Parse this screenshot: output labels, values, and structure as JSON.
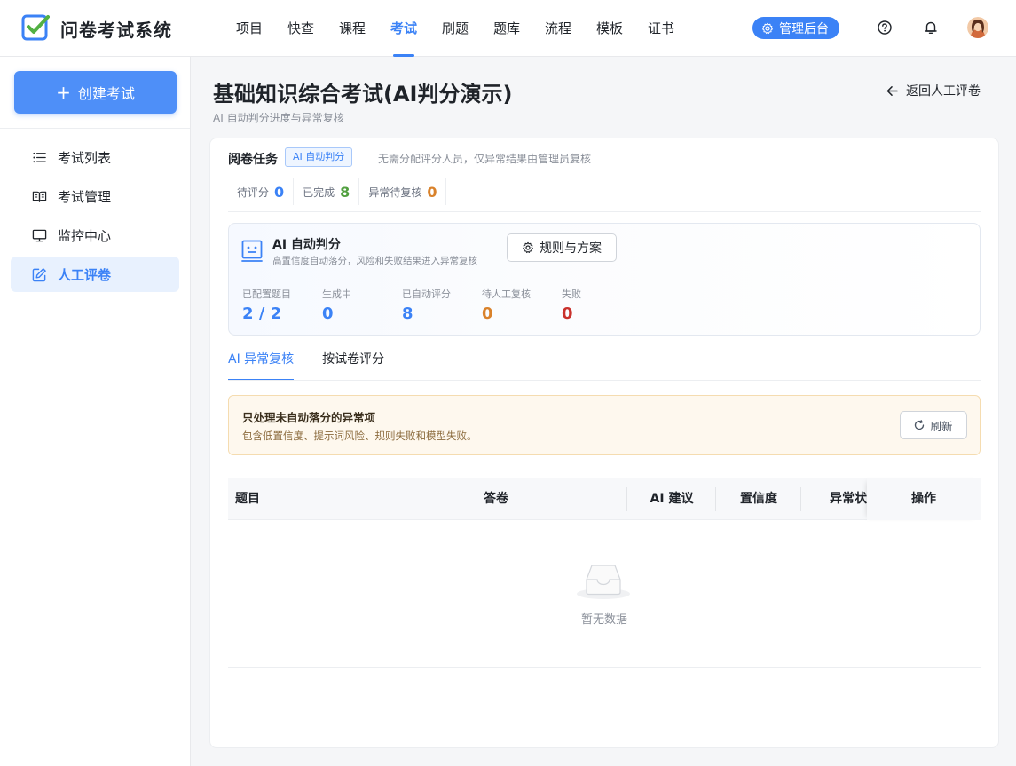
{
  "app": {
    "name": "问卷考试系统"
  },
  "nav": {
    "items": [
      "项目",
      "快查",
      "课程",
      "考试",
      "刷题",
      "题库",
      "流程",
      "模板",
      "证书"
    ],
    "active_index": 3
  },
  "header": {
    "admin_label": "管理后台"
  },
  "sidebar": {
    "create_label": "创建考试",
    "items": [
      {
        "label": "考试列表",
        "icon": "list-icon"
      },
      {
        "label": "考试管理",
        "icon": "book-icon"
      },
      {
        "label": "监控中心",
        "icon": "monitor-icon"
      },
      {
        "label": "人工评卷",
        "icon": "edit-icon"
      }
    ],
    "active_index": 3
  },
  "page": {
    "title": "基础知识综合考试(AI判分演示)",
    "subtitle": "AI 自动判分进度与异常复核",
    "back_label": "返回人工评卷"
  },
  "task": {
    "title": "阅卷任务",
    "tag": "AI 自动判分",
    "note": "无需分配评分人员，仅异常结果由管理员复核",
    "stats": [
      {
        "label": "待评分",
        "value": "0",
        "color": "#3b82f6"
      },
      {
        "label": "已完成",
        "value": "8",
        "color": "#52a040"
      },
      {
        "label": "异常待复核",
        "value": "0",
        "color": "#d9822b"
      }
    ]
  },
  "ai_panel": {
    "title": "AI 自动判分",
    "desc": "高置信度自动落分，风险和失败结果进入异常复核",
    "rules_label": "规则与方案",
    "metrics": [
      {
        "label": "已配置题目",
        "value": "2 / 2",
        "color": "#3b82f6"
      },
      {
        "label": "生成中",
        "value": "0",
        "color": "#3b82f6"
      },
      {
        "label": "已自动评分",
        "value": "8",
        "color": "#3b82f6"
      },
      {
        "label": "待人工复核",
        "value": "0",
        "color": "#d9822b"
      },
      {
        "label": "失败",
        "value": "0",
        "color": "#c9312c"
      }
    ]
  },
  "tabs": {
    "items": [
      "AI 异常复核",
      "按试卷评分"
    ],
    "active_index": 0
  },
  "alert": {
    "title": "只处理未自动落分的异常项",
    "desc": "包含低置信度、提示词风险、规则失败和模型失败。",
    "refresh_label": "刷新"
  },
  "table": {
    "columns": [
      "题目",
      "答卷",
      "AI 建议",
      "置信度",
      "异常状",
      "操作"
    ],
    "rows": [],
    "empty_text": "暂无数据"
  }
}
